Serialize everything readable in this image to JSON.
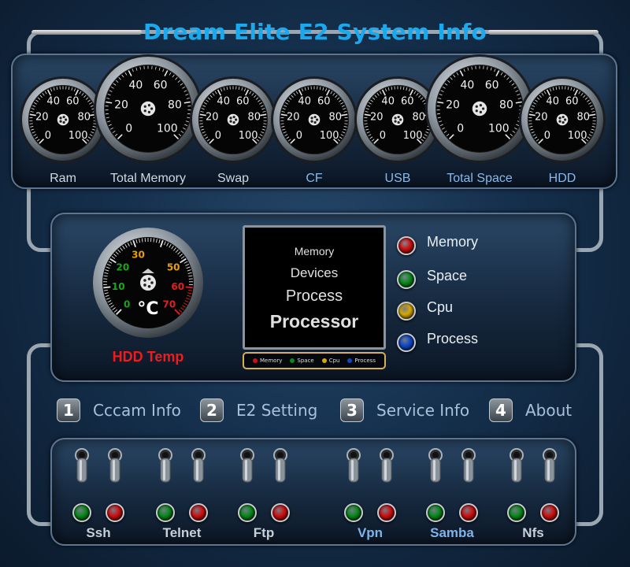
{
  "title": "Dream Elite E2 System Info",
  "gauges": [
    {
      "id": "ram",
      "label": "Ram",
      "size": "small",
      "label_color": "gray",
      "ticks": [
        "0",
        "20",
        "40",
        "60",
        "80",
        "100"
      ]
    },
    {
      "id": "total-memory",
      "label": "Total Memory",
      "size": "large",
      "label_color": "gray",
      "ticks": [
        "0",
        "20",
        "40",
        "60",
        "80",
        "100"
      ]
    },
    {
      "id": "swap",
      "label": "Swap",
      "size": "small",
      "label_color": "gray",
      "ticks": [
        "0",
        "20",
        "40",
        "60",
        "80",
        "100"
      ]
    },
    {
      "id": "cf",
      "label": "CF",
      "size": "small",
      "label_color": "blue",
      "ticks": [
        "0",
        "20",
        "40",
        "60",
        "80",
        "100"
      ]
    },
    {
      "id": "usb",
      "label": "USB",
      "size": "small",
      "label_color": "blue",
      "ticks": [
        "0",
        "20",
        "40",
        "60",
        "80",
        "100"
      ]
    },
    {
      "id": "total-space",
      "label": "Total Space",
      "size": "large",
      "label_color": "blue",
      "ticks": [
        "0",
        "20",
        "40",
        "60",
        "80",
        "100"
      ]
    },
    {
      "id": "hdd",
      "label": "HDD",
      "size": "small",
      "label_color": "blue",
      "ticks": [
        "0",
        "20",
        "40",
        "60",
        "80",
        "100"
      ]
    }
  ],
  "hdd_temp": {
    "label": "HDD Temp",
    "unit": "°C",
    "ticks": [
      "0",
      "10",
      "20",
      "30",
      "50",
      "60",
      "70"
    ]
  },
  "screen_lines": [
    "Memory",
    "Devices",
    "Process",
    "Processor"
  ],
  "legend_bar": [
    "Memory",
    "Space",
    "Cpu",
    "Process"
  ],
  "legend": [
    {
      "label": "Memory",
      "color": "#d01010"
    },
    {
      "label": "Space",
      "color": "#0a8a1a"
    },
    {
      "label": "Cpu",
      "color": "#d8a800"
    },
    {
      "label": "Process",
      "color": "#1048c8"
    }
  ],
  "tabs": [
    {
      "num": "1",
      "label": "Cccam Info"
    },
    {
      "num": "2",
      "label": "E2 Setting"
    },
    {
      "num": "3",
      "label": "Service Info"
    },
    {
      "num": "4",
      "label": "About"
    }
  ],
  "services": [
    {
      "label": "Ssh",
      "label_color": "gray"
    },
    {
      "label": "Telnet",
      "label_color": "gray"
    },
    {
      "label": "Ftp",
      "label_color": "gray"
    },
    {
      "label": "Vpn",
      "label_color": "blue"
    },
    {
      "label": "Samba",
      "label_color": "blue"
    },
    {
      "label": "Nfs",
      "label_color": "gray"
    }
  ],
  "colors": {
    "title": "#19a9ee",
    "led_on": "#0a8a1a",
    "led_off": "#d01010",
    "hdd_temp": "#ee1c1c"
  }
}
